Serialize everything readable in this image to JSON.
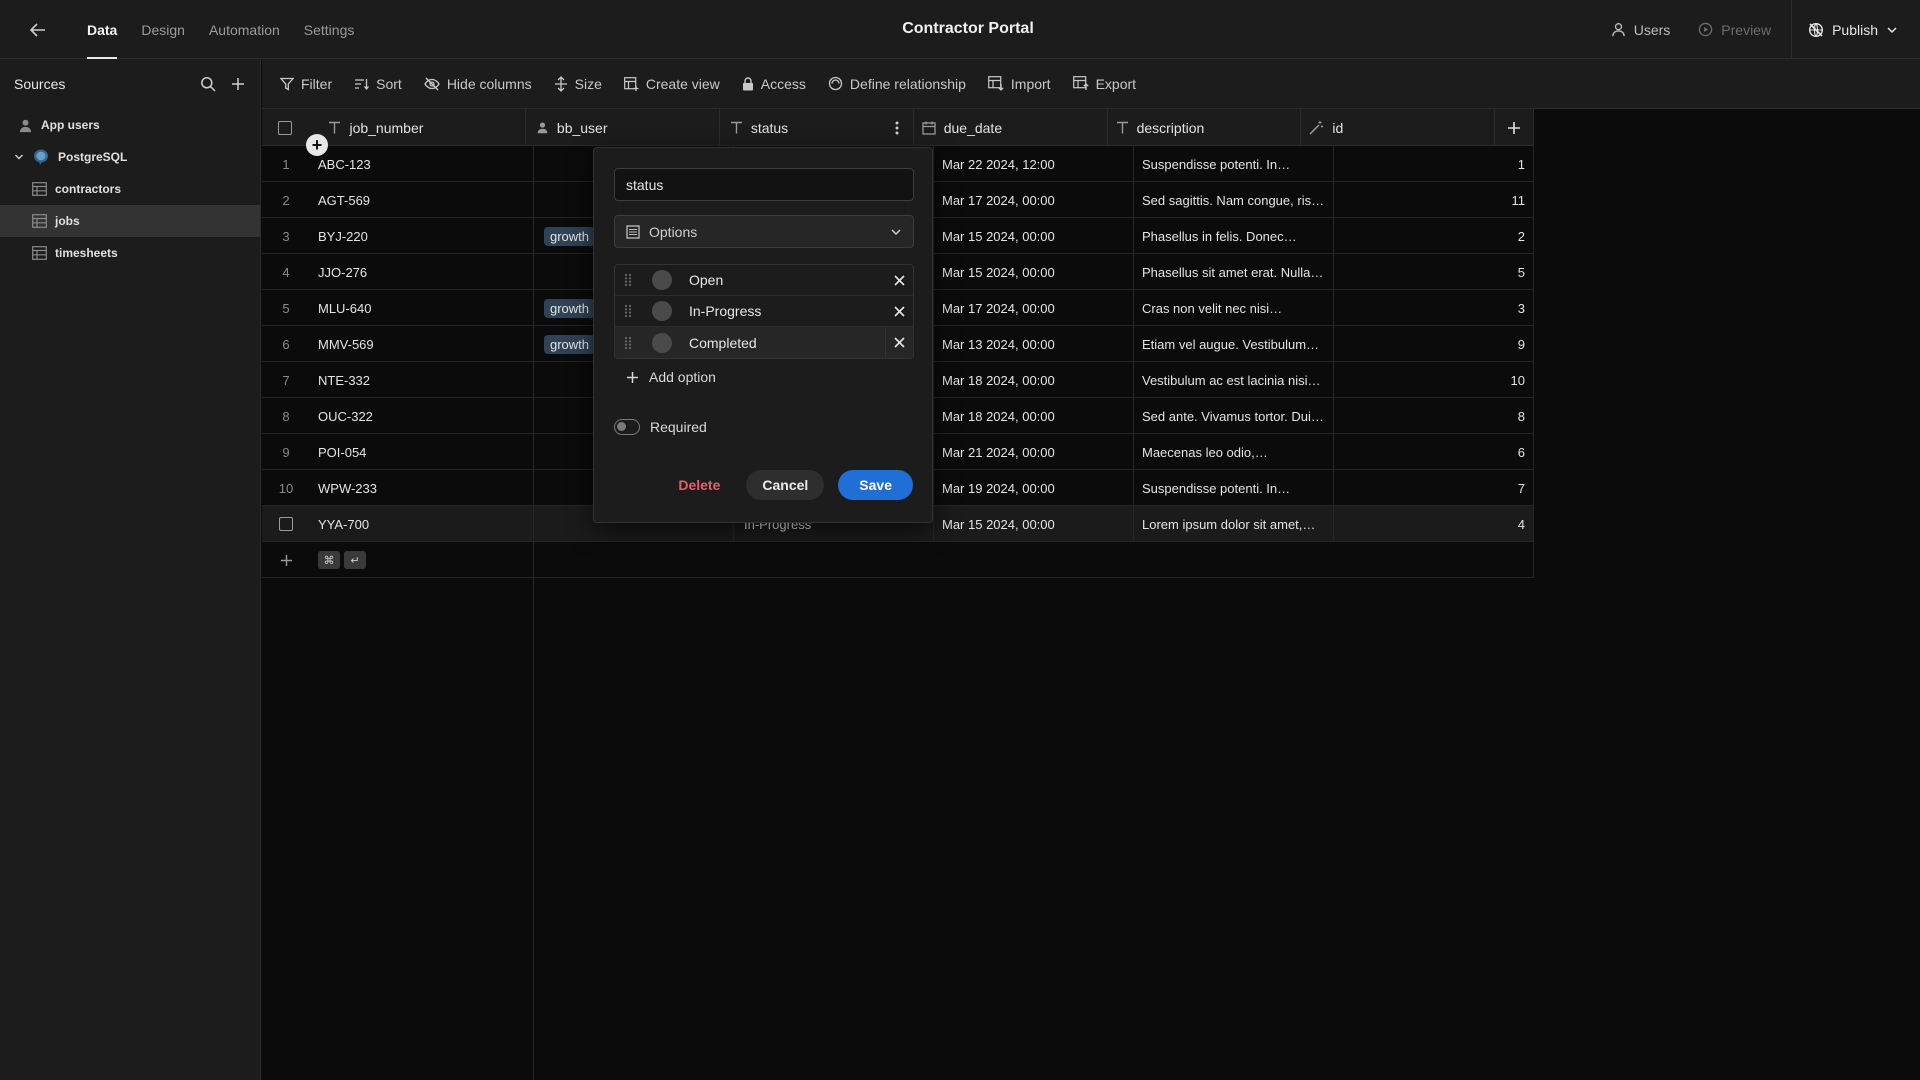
{
  "nav": {
    "tabs": [
      {
        "label": "Data",
        "active": true
      },
      {
        "label": "Design",
        "active": false
      },
      {
        "label": "Automation",
        "active": false
      },
      {
        "label": "Settings",
        "active": false
      }
    ],
    "app_title": "Contractor Portal",
    "users_label": "Users",
    "preview_label": "Preview",
    "publish_label": "Publish"
  },
  "sidebar": {
    "title": "Sources",
    "items": [
      {
        "label": "App users",
        "icon": "user-icon",
        "level": 0
      },
      {
        "label": "PostgreSQL",
        "icon": "postgres-icon",
        "level": 0
      },
      {
        "label": "contractors",
        "icon": "table-icon",
        "level": 1
      },
      {
        "label": "jobs",
        "icon": "table-icon",
        "level": 1,
        "active": true
      },
      {
        "label": "timesheets",
        "icon": "table-icon",
        "level": 1
      }
    ]
  },
  "toolbar": {
    "filter": "Filter",
    "sort": "Sort",
    "hide_columns": "Hide columns",
    "size": "Size",
    "create_view": "Create view",
    "access": "Access",
    "define_relationship": "Define relationship",
    "import": "Import",
    "export": "Export"
  },
  "table": {
    "columns": [
      {
        "key": "job_number",
        "label": "job_number",
        "icon": "text-icon"
      },
      {
        "key": "bb_user",
        "label": "bb_user",
        "icon": "user-icon"
      },
      {
        "key": "status",
        "label": "status",
        "icon": "text-icon"
      },
      {
        "key": "due_date",
        "label": "due_date",
        "icon": "calendar-icon"
      },
      {
        "key": "description",
        "label": "description",
        "icon": "text-icon"
      },
      {
        "key": "id",
        "label": "id",
        "icon": "magic-wand-icon"
      }
    ],
    "rows": [
      {
        "idx": "1",
        "job_number": "ABC-123",
        "bb_user": "",
        "status": "",
        "due_date": "Mar 22 2024, 12:00",
        "description": "Suspendisse potenti. In…",
        "id": "1"
      },
      {
        "idx": "2",
        "job_number": "AGT-569",
        "bb_user": "",
        "status": "",
        "due_date": "Mar 17 2024, 00:00",
        "description": "Sed sagittis. Nam congue, ris…",
        "id": "11"
      },
      {
        "idx": "3",
        "job_number": "BYJ-220",
        "bb_user": "growth",
        "status": "",
        "due_date": "Mar 15 2024, 00:00",
        "description": "Phasellus in felis. Donec…",
        "id": "2"
      },
      {
        "idx": "4",
        "job_number": "JJO-276",
        "bb_user": "",
        "status": "",
        "due_date": "Mar 15 2024, 00:00",
        "description": "Phasellus sit amet erat. Nulla…",
        "id": "5"
      },
      {
        "idx": "5",
        "job_number": "MLU-640",
        "bb_user": "growth",
        "status": "",
        "due_date": "Mar 17 2024, 00:00",
        "description": "Cras non velit nec nisi…",
        "id": "3"
      },
      {
        "idx": "6",
        "job_number": "MMV-569",
        "bb_user": "growth",
        "status": "",
        "due_date": "Mar 13 2024, 00:00",
        "description": "Etiam vel augue. Vestibulum…",
        "id": "9"
      },
      {
        "idx": "7",
        "job_number": "NTE-332",
        "bb_user": "",
        "status": "",
        "due_date": "Mar 18 2024, 00:00",
        "description": "Vestibulum ac est lacinia nisi…",
        "id": "10"
      },
      {
        "idx": "8",
        "job_number": "OUC-322",
        "bb_user": "",
        "status": "",
        "due_date": "Mar 18 2024, 00:00",
        "description": "Sed ante. Vivamus tortor. Dui…",
        "id": "8"
      },
      {
        "idx": "9",
        "job_number": "POI-054",
        "bb_user": "",
        "status": "",
        "due_date": "Mar 21 2024, 00:00",
        "description": "Maecenas leo odio,…",
        "id": "6"
      },
      {
        "idx": "10",
        "job_number": "WPW-233",
        "bb_user": "",
        "status": "",
        "due_date": "Mar 19 2024, 00:00",
        "description": "Suspendisse potenti. In…",
        "id": "7"
      },
      {
        "idx": "",
        "job_number": "YYA-700",
        "bb_user": "",
        "status": "In-Progress",
        "due_date": "Mar 15 2024, 00:00",
        "description": "Lorem ipsum dolor sit amet,…",
        "id": "4",
        "hover": true
      }
    ],
    "add_row_shortcut": [
      "⌘",
      "↵"
    ]
  },
  "popover": {
    "name_value": "status",
    "type_label": "Options",
    "options": [
      {
        "label": "Open"
      },
      {
        "label": "In-Progress"
      },
      {
        "label": "Completed",
        "selected": true
      }
    ],
    "add_option_label": "Add option",
    "required_label": "Required",
    "required": false,
    "delete_label": "Delete",
    "cancel_label": "Cancel",
    "save_label": "Save"
  },
  "colors": {
    "accent": "#1f6fd6",
    "danger": "#e0606e",
    "tag_bg": "#2f4256"
  }
}
